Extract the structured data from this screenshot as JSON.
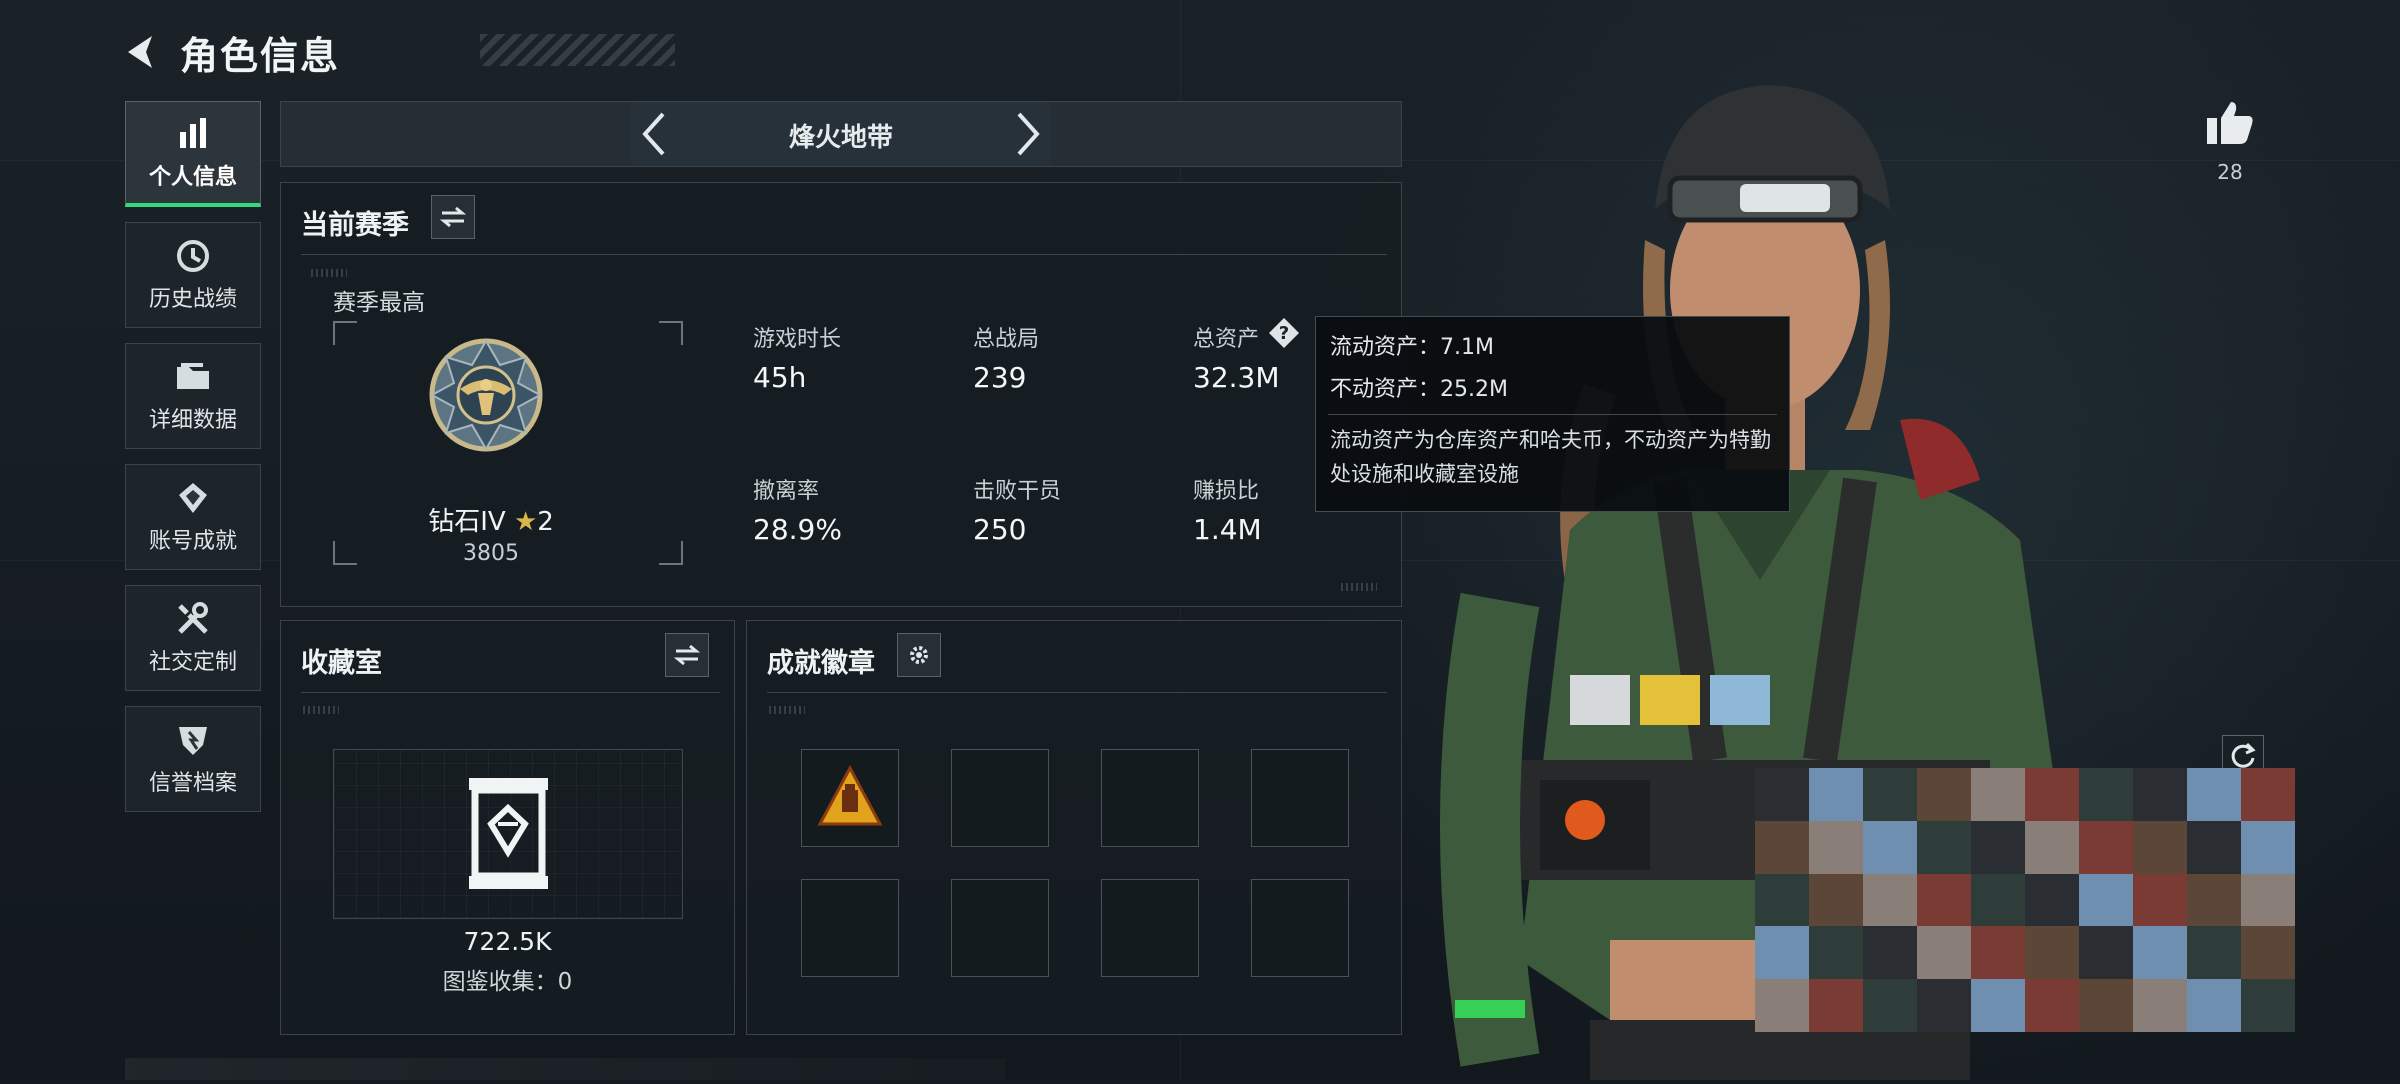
{
  "header": {
    "title": "角色信息"
  },
  "sidebar": {
    "items": [
      {
        "label": "个人信息",
        "icon": "bar-chart-icon",
        "active": true
      },
      {
        "label": "历史战绩",
        "icon": "history-icon"
      },
      {
        "label": "详细数据",
        "icon": "folder-icon"
      },
      {
        "label": "账号成就",
        "icon": "achievement-icon"
      },
      {
        "label": "社交定制",
        "icon": "tools-icon"
      },
      {
        "label": "信誉档案",
        "icon": "shield-icon"
      }
    ]
  },
  "mode": {
    "label": "烽火地带"
  },
  "season": {
    "title": "当前赛季",
    "highest_label": "赛季最高",
    "rank_name": "钻石IV",
    "rank_stars": "2",
    "rank_score": "3805",
    "stats": [
      {
        "label": "游戏时长",
        "value": "45h"
      },
      {
        "label": "总战局",
        "value": "239"
      },
      {
        "label": "总资产",
        "value": "32.3M"
      },
      {
        "label": "撤离率",
        "value": "28.9%"
      },
      {
        "label": "击败干员",
        "value": "250"
      },
      {
        "label": "赚损比",
        "value": "1.4M"
      }
    ]
  },
  "tooltip": {
    "liquid": "流动资产：7.1M",
    "fixed": "不动资产：25.2M",
    "description": "流动资产为仓库资产和哈夫币，不动资产为特勤处设施和收藏室设施"
  },
  "collection": {
    "title": "收藏室",
    "value": "722.5K",
    "gallery": "图鉴收集：0"
  },
  "badges": {
    "title": "成就徽章"
  },
  "likes": {
    "count": "28"
  },
  "colors": {
    "accent": "#36d97a",
    "panel_border": "#3a444b",
    "background": "#141b21"
  }
}
